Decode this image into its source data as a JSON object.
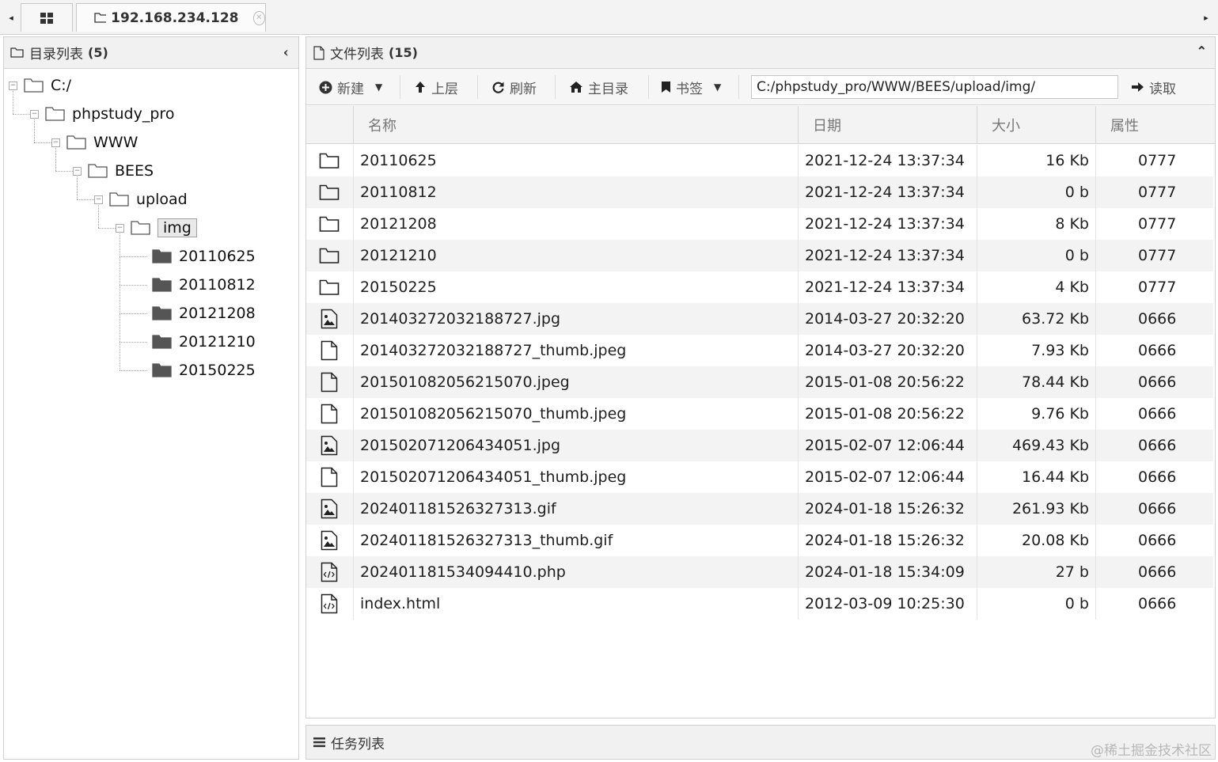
{
  "tabs": {
    "home_icon": "grid-icon",
    "connection": {
      "label": "192.168.234.128",
      "icon": "folder-icon"
    },
    "left_arrow": "◂",
    "right_arrow": "▸"
  },
  "left_panel": {
    "title": "目录列表",
    "count": "(5)",
    "tree": [
      {
        "label": "C:/",
        "depth": 0,
        "type": "folder-open",
        "toggle": "−"
      },
      {
        "label": "phpstudy_pro",
        "depth": 1,
        "type": "folder-open",
        "toggle": "−"
      },
      {
        "label": "WWW",
        "depth": 2,
        "type": "folder-open",
        "toggle": "−"
      },
      {
        "label": "BEES",
        "depth": 3,
        "type": "folder-open",
        "toggle": "−"
      },
      {
        "label": "upload",
        "depth": 4,
        "type": "folder-open",
        "toggle": "−"
      },
      {
        "label": "img",
        "depth": 5,
        "type": "folder-open",
        "toggle": "−",
        "selected": true
      },
      {
        "label": "20110625",
        "depth": 6,
        "type": "folder-closed"
      },
      {
        "label": "20110812",
        "depth": 6,
        "type": "folder-closed"
      },
      {
        "label": "20121208",
        "depth": 6,
        "type": "folder-closed"
      },
      {
        "label": "20121210",
        "depth": 6,
        "type": "folder-closed"
      },
      {
        "label": "20150225",
        "depth": 6,
        "type": "folder-closed"
      }
    ]
  },
  "right_panel": {
    "title": "文件列表",
    "count": "(15)",
    "toolbar": {
      "new_label": "新建",
      "up_label": "上层",
      "refresh_label": "刷新",
      "home_label": "主目录",
      "bookmark_label": "书签",
      "path_value": "C:/phpstudy_pro/WWW/BEES/upload/img/",
      "read_label": "读取"
    },
    "columns": {
      "name": "名称",
      "date": "日期",
      "size": "大小",
      "attr": "属性"
    },
    "files": [
      {
        "icon": "folder",
        "name": "20110625",
        "date": "2021-12-24 13:37:34",
        "size": "16 Kb",
        "attr": "0777"
      },
      {
        "icon": "folder",
        "name": "20110812",
        "date": "2021-12-24 13:37:34",
        "size": "0 b",
        "attr": "0777"
      },
      {
        "icon": "folder",
        "name": "20121208",
        "date": "2021-12-24 13:37:34",
        "size": "8 Kb",
        "attr": "0777"
      },
      {
        "icon": "folder",
        "name": "20121210",
        "date": "2021-12-24 13:37:34",
        "size": "0 b",
        "attr": "0777"
      },
      {
        "icon": "folder",
        "name": "20150225",
        "date": "2021-12-24 13:37:34",
        "size": "4 Kb",
        "attr": "0777"
      },
      {
        "icon": "image",
        "name": "201403272032188727.jpg",
        "date": "2014-03-27 20:32:20",
        "size": "63.72 Kb",
        "attr": "0666"
      },
      {
        "icon": "file",
        "name": "201403272032188727_thumb.jpeg",
        "date": "2014-03-27 20:32:20",
        "size": "7.93 Kb",
        "attr": "0666"
      },
      {
        "icon": "file",
        "name": "201501082056215070.jpeg",
        "date": "2015-01-08 20:56:22",
        "size": "78.44 Kb",
        "attr": "0666"
      },
      {
        "icon": "file",
        "name": "201501082056215070_thumb.jpeg",
        "date": "2015-01-08 20:56:22",
        "size": "9.76 Kb",
        "attr": "0666"
      },
      {
        "icon": "image",
        "name": "201502071206434051.jpg",
        "date": "2015-02-07 12:06:44",
        "size": "469.43 Kb",
        "attr": "0666"
      },
      {
        "icon": "file",
        "name": "201502071206434051_thumb.jpeg",
        "date": "2015-02-07 12:06:44",
        "size": "16.44 Kb",
        "attr": "0666"
      },
      {
        "icon": "image",
        "name": "202401181526327313.gif",
        "date": "2024-01-18 15:26:32",
        "size": "261.93 Kb",
        "attr": "0666"
      },
      {
        "icon": "image",
        "name": "202401181526327313_thumb.gif",
        "date": "2024-01-18 15:26:32",
        "size": "20.08 Kb",
        "attr": "0666"
      },
      {
        "icon": "code",
        "name": "202401181534094410.php",
        "date": "2024-01-18 15:34:09",
        "size": "27 b",
        "attr": "0666"
      },
      {
        "icon": "code",
        "name": "index.html",
        "date": "2012-03-09 10:25:30",
        "size": "0 b",
        "attr": "0666"
      }
    ]
  },
  "task_panel": {
    "title": "任务列表"
  },
  "watermark": "@稀土掘金技术社区"
}
